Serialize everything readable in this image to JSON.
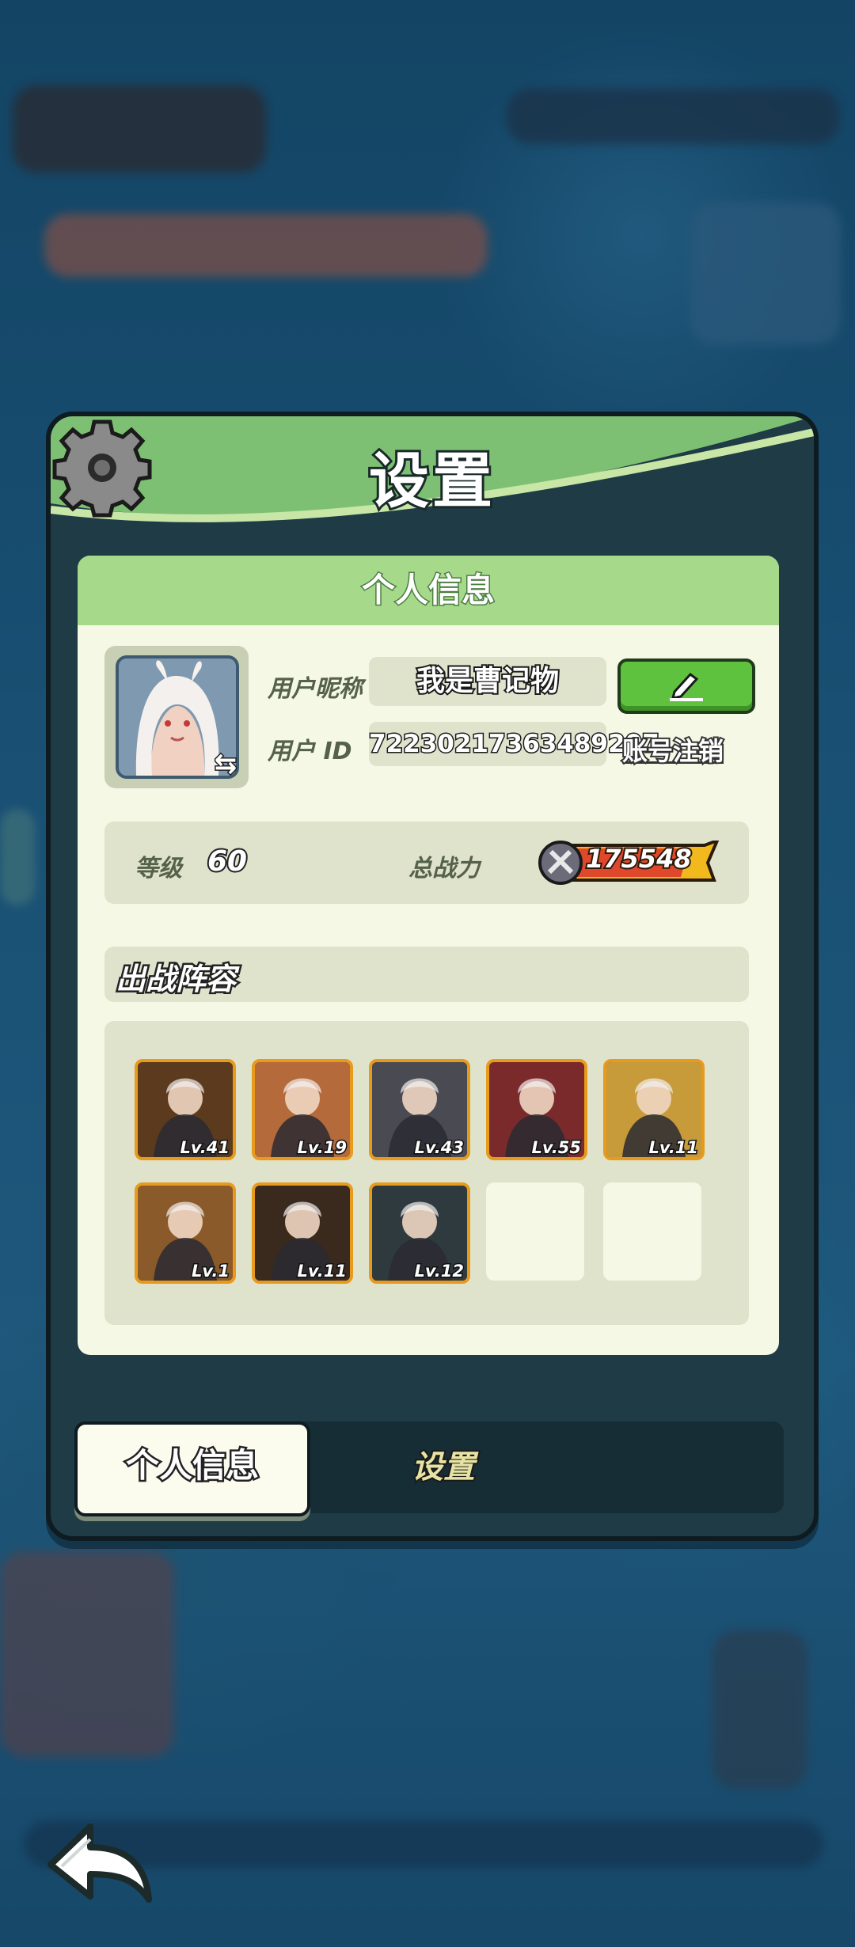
{
  "panel": {
    "title": "设置"
  },
  "profile": {
    "section_title": "个人信息",
    "nickname_label": "用户昵称",
    "nickname": "我是曹记物",
    "id_label": "用户  ID",
    "user_id": "72230217363489207",
    "deregister_link": "账号注销"
  },
  "stats": {
    "level_label": "等级",
    "level": "60",
    "power_label": "总战力",
    "power": "175548"
  },
  "lineup": {
    "title": "出战阵容",
    "heroes": [
      {
        "name": "hero-1",
        "level": "Lv.41",
        "color": "#5b3a1e"
      },
      {
        "name": "hero-2",
        "level": "Lv.19",
        "color": "#b46a3a"
      },
      {
        "name": "hero-3",
        "level": "Lv.43",
        "color": "#4a4a52"
      },
      {
        "name": "hero-4",
        "level": "Lv.55",
        "color": "#7a2a2a"
      },
      {
        "name": "hero-5",
        "level": "Lv.11",
        "color": "#c79a3a"
      },
      {
        "name": "hero-6",
        "level": "Lv.1",
        "color": "#8a5a2a"
      },
      {
        "name": "hero-7",
        "level": "Lv.11",
        "color": "#3a2a1e"
      },
      {
        "name": "hero-8",
        "level": "Lv.12",
        "color": "#2e3a3e"
      }
    ],
    "empty_slots": 2
  },
  "tabs": {
    "active": "个人信息",
    "other": "设置"
  },
  "colors": {
    "accent_green": "#7ec073",
    "card_bg": "#f5f8e4",
    "hero_border": "#e89a1d"
  }
}
